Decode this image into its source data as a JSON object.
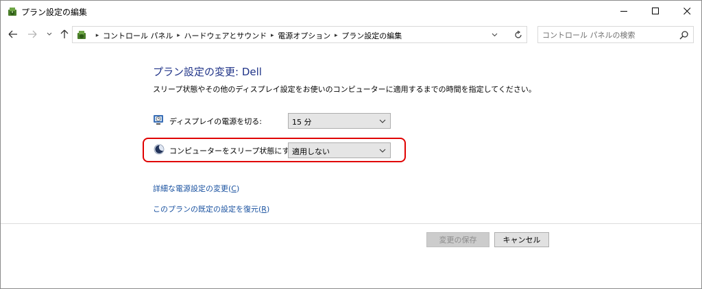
{
  "window": {
    "title": "プラン設定の編集"
  },
  "addressbar": {
    "crumbs": [
      "コントロール パネル",
      "ハードウェアとサウンド",
      "電源オプション",
      "プラン設定の編集"
    ]
  },
  "search": {
    "placeholder": "コントロール パネルの検索"
  },
  "content": {
    "heading": "プラン設定の変更: Dell",
    "description": "スリープ状態やその他のディスプレイ設定をお使いのコンピューターに適用するまでの時間を指定してください。",
    "display_off": {
      "label": "ディスプレイの電源を切る:",
      "value": "15 分"
    },
    "sleep": {
      "label": "コンピューターをスリープ状態にする:",
      "value": "適用しない"
    },
    "links": {
      "advanced_text": "詳細な電源設定の変更(",
      "advanced_key": "C",
      "advanced_end": ")",
      "restore_text": "このプランの既定の設定を復元(",
      "restore_key": "R",
      "restore_end": ")"
    }
  },
  "buttons": {
    "save": "変更の保存",
    "cancel": "キャンセル"
  },
  "colors": {
    "heading": "#1e3287",
    "link": "#1a52a0",
    "highlight": "#e00000"
  }
}
